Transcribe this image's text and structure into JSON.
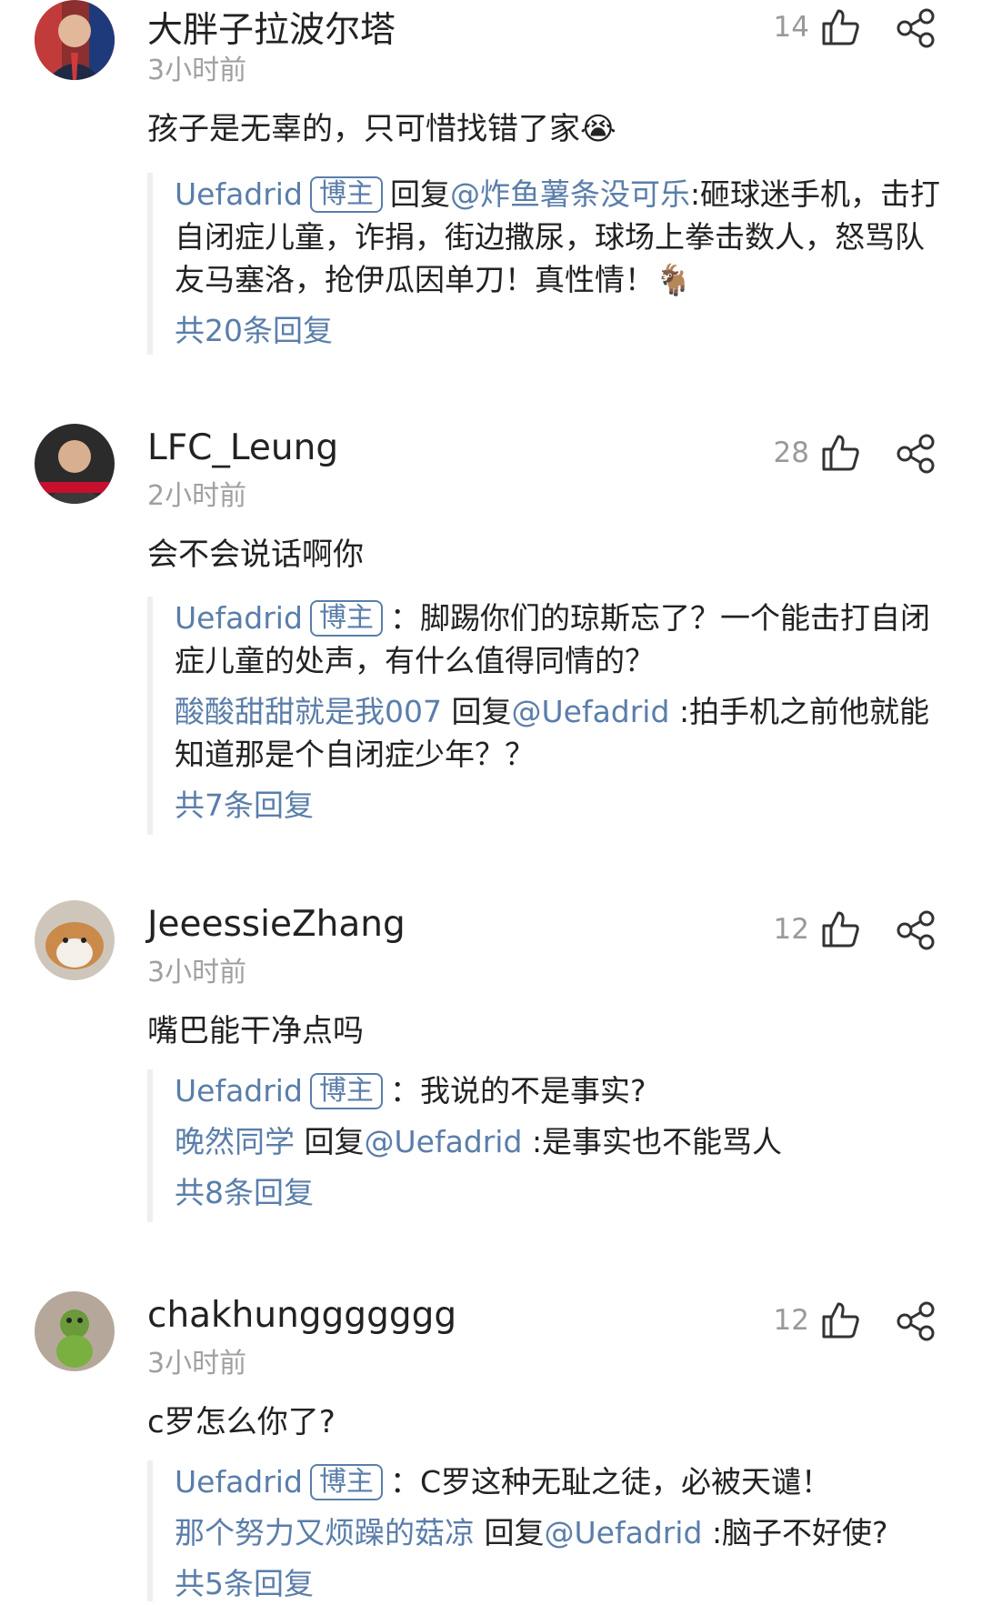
{
  "comments": [
    {
      "username": "大胖子拉波尔塔",
      "time": "3小时前",
      "likes": "14",
      "content": "孩子是无辜的，只可惜找错了家",
      "emoji": "😭",
      "replies": [
        {
          "user": "Uefadrid",
          "badge": "博主",
          "prefix": "回复",
          "target": "@炸鱼薯条没可乐",
          "text": ":砸球迷手机，击打自闭症儿童，诈捐，街边撒尿，球场上拳击数人，怒骂队友马塞洛，抢伊瓜因单刀！真性情！",
          "emoji": "🐐"
        }
      ],
      "more": "共20条回复"
    },
    {
      "username": "LFC_Leung",
      "time": "2小时前",
      "likes": "28",
      "content": "会不会说话啊你",
      "replies": [
        {
          "user": "Uefadrid",
          "badge": "博主",
          "text": "：脚踢你们的琼斯忘了？一个能击打自闭症儿童的处声，有什么值得同情的？"
        },
        {
          "user": "酸酸甜甜就是我007",
          "prefix": "回复",
          "target": "@Uefadrid",
          "text": ":拍手机之前他就能知道那是个自闭症少年？？"
        }
      ],
      "more": "共7条回复"
    },
    {
      "username": "JeeessieZhang",
      "time": "3小时前",
      "likes": "12",
      "content": "嘴巴能干净点吗",
      "replies": [
        {
          "user": "Uefadrid",
          "badge": "博主",
          "text": "：我说的不是事实?"
        },
        {
          "user": "晚然同学",
          "prefix": "回复",
          "target": "@Uefadrid",
          "text": ":是事实也不能骂人"
        }
      ],
      "more": "共8条回复"
    },
    {
      "username": "chakhunggggggg",
      "time": "3小时前",
      "likes": "12",
      "content": "c罗怎么你了?",
      "replies": [
        {
          "user": "Uefadrid",
          "badge": "博主",
          "text": "：C罗这种无耻之徒，必被天谴！"
        },
        {
          "user": "那个努力又烦躁的菇凉",
          "prefix": "回复",
          "target": "@Uefadrid",
          "text": ":脑子不好使?"
        }
      ],
      "more": "共5条回复"
    }
  ],
  "colors": {
    "link_blue": "#5a7eaa",
    "time_gray": "#a0a0a0",
    "text": "#222222"
  },
  "icons": [
    "like-icon",
    "share-icon"
  ]
}
